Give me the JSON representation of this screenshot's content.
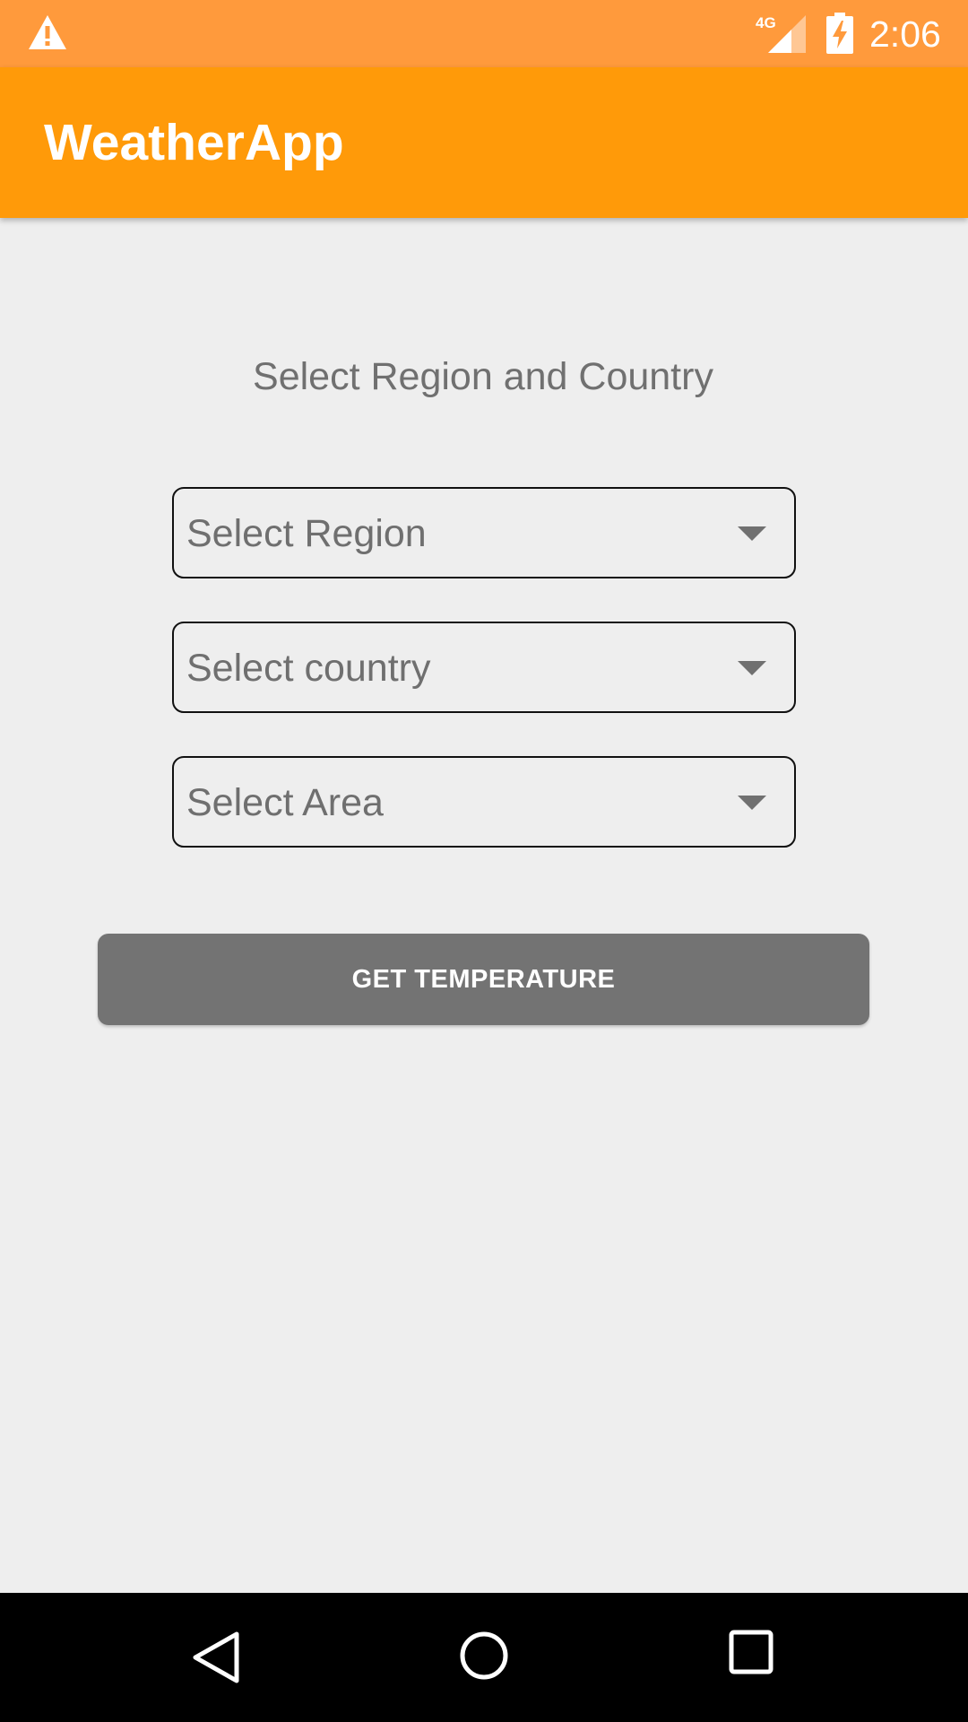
{
  "status_bar": {
    "time": "2:06",
    "network_label": "4G",
    "icons": [
      "warning-icon",
      "signal-icon",
      "battery-charging-icon"
    ]
  },
  "app_bar": {
    "title": "WeatherApp",
    "color": "#ff9a09"
  },
  "main": {
    "heading": "Select Region and Country",
    "spinners": [
      {
        "label": "Select Region"
      },
      {
        "label": "Select country"
      },
      {
        "label": "Select Area"
      }
    ],
    "button_label": "GET TEMPERATURE"
  },
  "nav_bar": {
    "icons": [
      "back-icon",
      "home-icon",
      "recents-icon"
    ]
  },
  "colors": {
    "status_bar": "#ff9a3c",
    "app_bar": "#ff9a09",
    "background": "#eeeeee",
    "button": "#737373",
    "hint_text": "#6f6f6f"
  }
}
